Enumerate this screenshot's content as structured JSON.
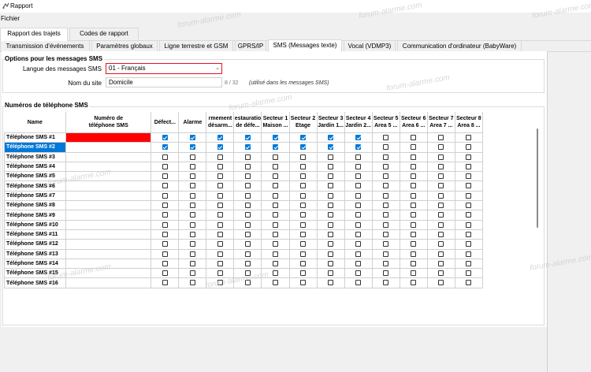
{
  "window": {
    "title": "Rapport",
    "icon": "report-app-icon"
  },
  "menu": {
    "file": "Fichier"
  },
  "tabs_top": [
    {
      "label": "Rapport des trajets",
      "active": true
    },
    {
      "label": "Codes de rapport",
      "active": false
    }
  ],
  "tabs_sub": [
    {
      "label": "Transmission d'événements",
      "active": false
    },
    {
      "label": "Paramètres globaux",
      "active": false
    },
    {
      "label": "Ligne terrestre et GSM",
      "active": false
    },
    {
      "label": "GPRS/IP",
      "active": false
    },
    {
      "label": "SMS (Messages texte)",
      "active": true
    },
    {
      "label": "Vocal (VDMP3)",
      "active": false
    },
    {
      "label": "Communication d'ordinateur (BabyWare)",
      "active": false
    }
  ],
  "options": {
    "title": "Options pour les messages SMS",
    "language_label": "Langue des messages SMS",
    "language_value": "01 - Français",
    "site_label": "Nom du site",
    "site_value": "Domicile",
    "site_counter": "8 / 32",
    "site_hint": "(utilisé dans les messages SMS)"
  },
  "phones": {
    "title": "Numéros de téléphone SMS",
    "columns": [
      [
        "Name"
      ],
      [
        "Numéro de",
        "téléphone SMS"
      ],
      [
        "Défect..."
      ],
      [
        "Alarme"
      ],
      [
        "rmement",
        "désarm..."
      ],
      [
        "estauratio",
        "de défe..."
      ],
      [
        "Secteur 1",
        "Maison ..."
      ],
      [
        "Secteur 2",
        "Etage"
      ],
      [
        "Secteur 3",
        "Jardin 1..."
      ],
      [
        "Secteur 4",
        "Jardin 2..."
      ],
      [
        "Secteur 5",
        "Area 5 ..."
      ],
      [
        "Secteur 6",
        "Area 6 ..."
      ],
      [
        "Secteur 7",
        "Area 7 ..."
      ],
      [
        "Secteur 8",
        "Area 8 ..."
      ]
    ],
    "rows": [
      {
        "name": "Téléphone SMS #1",
        "number": "",
        "invalid": true,
        "selected": false,
        "checks": [
          1,
          1,
          1,
          1,
          1,
          1,
          1,
          1,
          0,
          0,
          0,
          0
        ]
      },
      {
        "name": "Téléphone SMS #2",
        "number": "",
        "invalid": false,
        "selected": true,
        "checks": [
          1,
          1,
          1,
          1,
          1,
          1,
          1,
          1,
          0,
          0,
          0,
          0
        ]
      },
      {
        "name": "Téléphone SMS #3",
        "number": "",
        "invalid": false,
        "selected": false,
        "checks": [
          0,
          0,
          0,
          0,
          0,
          0,
          0,
          0,
          0,
          0,
          0,
          0
        ]
      },
      {
        "name": "Téléphone SMS #4",
        "number": "",
        "invalid": false,
        "selected": false,
        "checks": [
          0,
          0,
          0,
          0,
          0,
          0,
          0,
          0,
          0,
          0,
          0,
          0
        ]
      },
      {
        "name": "Téléphone SMS #5",
        "number": "",
        "invalid": false,
        "selected": false,
        "checks": [
          0,
          0,
          0,
          0,
          0,
          0,
          0,
          0,
          0,
          0,
          0,
          0
        ]
      },
      {
        "name": "Téléphone SMS #6",
        "number": "",
        "invalid": false,
        "selected": false,
        "checks": [
          0,
          0,
          0,
          0,
          0,
          0,
          0,
          0,
          0,
          0,
          0,
          0
        ]
      },
      {
        "name": "Téléphone SMS #7",
        "number": "",
        "invalid": false,
        "selected": false,
        "checks": [
          0,
          0,
          0,
          0,
          0,
          0,
          0,
          0,
          0,
          0,
          0,
          0
        ]
      },
      {
        "name": "Téléphone SMS #8",
        "number": "",
        "invalid": false,
        "selected": false,
        "checks": [
          0,
          0,
          0,
          0,
          0,
          0,
          0,
          0,
          0,
          0,
          0,
          0
        ]
      },
      {
        "name": "Téléphone SMS #9",
        "number": "",
        "invalid": false,
        "selected": false,
        "checks": [
          0,
          0,
          0,
          0,
          0,
          0,
          0,
          0,
          0,
          0,
          0,
          0
        ]
      },
      {
        "name": "Téléphone SMS #10",
        "number": "",
        "invalid": false,
        "selected": false,
        "checks": [
          0,
          0,
          0,
          0,
          0,
          0,
          0,
          0,
          0,
          0,
          0,
          0
        ]
      },
      {
        "name": "Téléphone SMS #11",
        "number": "",
        "invalid": false,
        "selected": false,
        "checks": [
          0,
          0,
          0,
          0,
          0,
          0,
          0,
          0,
          0,
          0,
          0,
          0
        ]
      },
      {
        "name": "Téléphone SMS #12",
        "number": "",
        "invalid": false,
        "selected": false,
        "checks": [
          0,
          0,
          0,
          0,
          0,
          0,
          0,
          0,
          0,
          0,
          0,
          0
        ]
      },
      {
        "name": "Téléphone SMS #13",
        "number": "",
        "invalid": false,
        "selected": false,
        "checks": [
          0,
          0,
          0,
          0,
          0,
          0,
          0,
          0,
          0,
          0,
          0,
          0
        ]
      },
      {
        "name": "Téléphone SMS #14",
        "number": "",
        "invalid": false,
        "selected": false,
        "checks": [
          0,
          0,
          0,
          0,
          0,
          0,
          0,
          0,
          0,
          0,
          0,
          0
        ]
      },
      {
        "name": "Téléphone SMS #15",
        "number": "",
        "invalid": false,
        "selected": false,
        "checks": [
          0,
          0,
          0,
          0,
          0,
          0,
          0,
          0,
          0,
          0,
          0,
          0
        ]
      },
      {
        "name": "Téléphone SMS #16",
        "number": "",
        "invalid": false,
        "selected": false,
        "checks": [
          0,
          0,
          0,
          0,
          0,
          0,
          0,
          0,
          0,
          0,
          0,
          0
        ]
      }
    ]
  },
  "colors": {
    "selection": "#0078d7",
    "invalid": "#ff0000",
    "select_border": "#e81123"
  },
  "watermark": "forum-alarme.com"
}
